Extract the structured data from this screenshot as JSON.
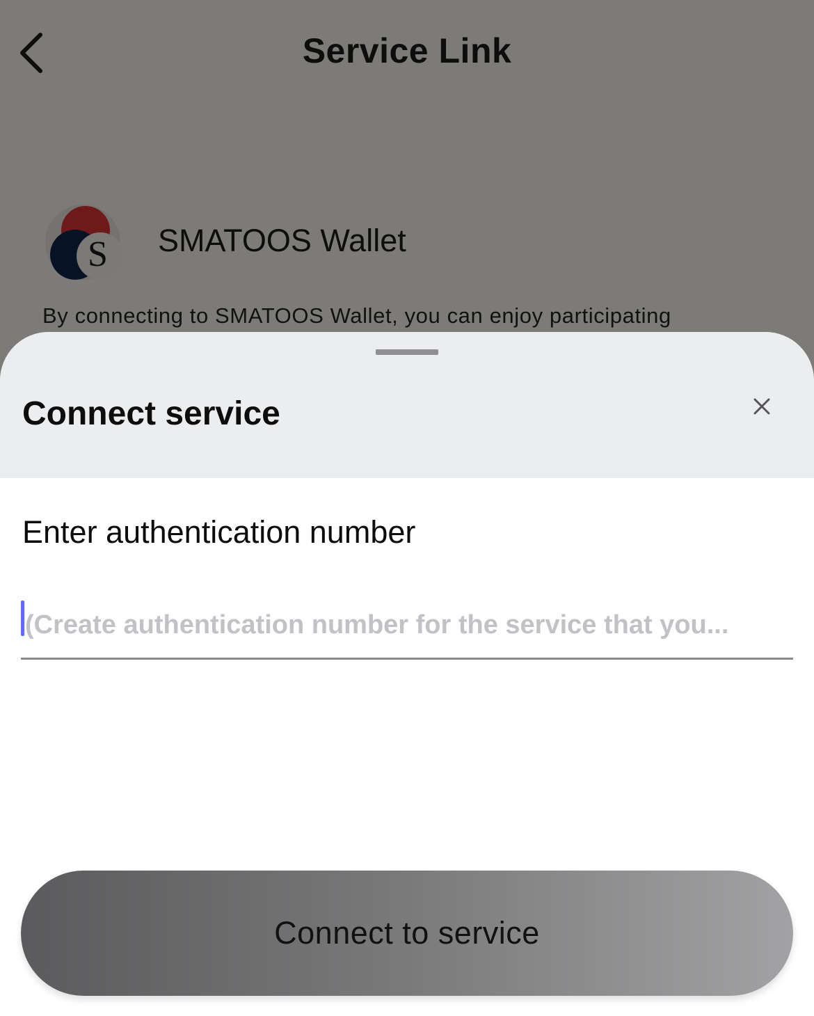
{
  "header": {
    "title": "Service Link",
    "back_icon": "chevron-left-icon"
  },
  "service": {
    "name": "SMATOOS Wallet",
    "logo_letter": "S",
    "description": "By connecting to SMATOOS Wallet, you can enjoy participating"
  },
  "sheet": {
    "title": "Connect service",
    "close_icon": "close-icon",
    "field_label": "Enter authentication number",
    "input_value": "",
    "input_placeholder": "(Create authentication number for the service that you...",
    "connect_label": "Connect to service"
  },
  "colors": {
    "dim_overlay": "#7c7b78",
    "sheet_header_bg": "#ecedef",
    "caret": "#5b6cff",
    "logo_red": "#6e1a1a",
    "logo_navy": "#081225"
  }
}
